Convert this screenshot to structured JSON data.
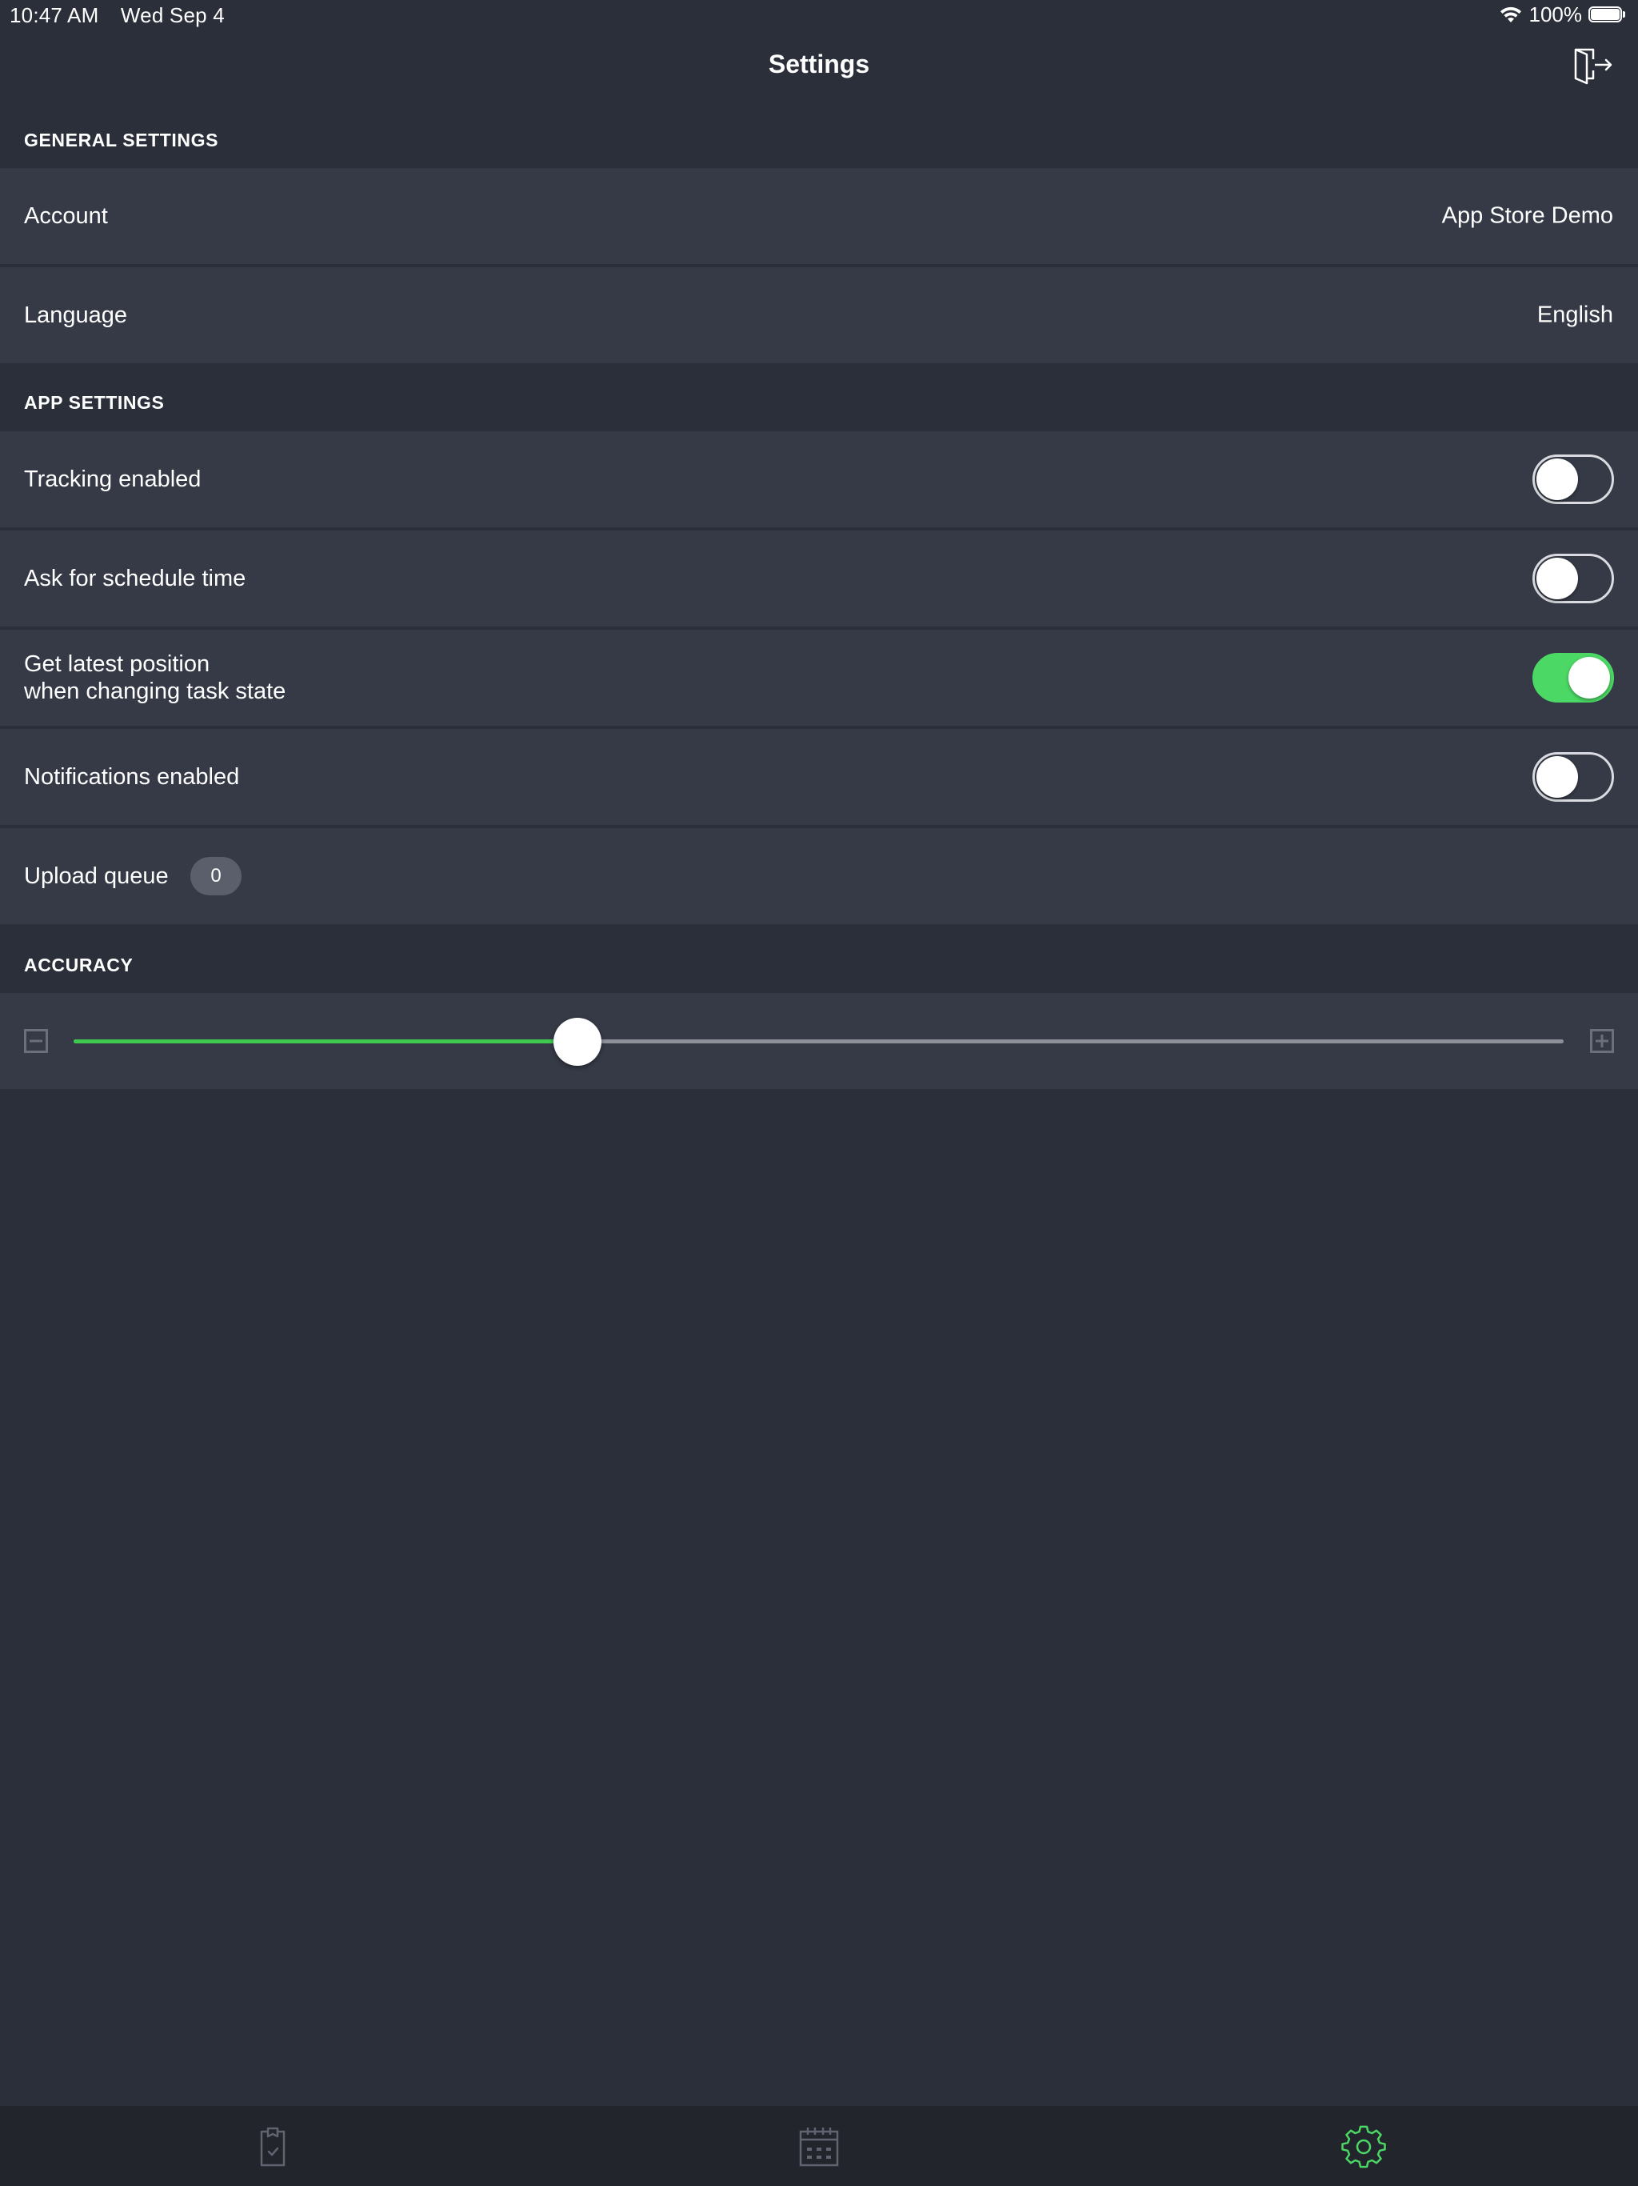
{
  "status_bar": {
    "time": "10:47 AM",
    "date": "Wed Sep 4",
    "battery": "100%"
  },
  "header": {
    "title": "Settings"
  },
  "general_settings": {
    "header": "GENERAL SETTINGS",
    "account_label": "Account",
    "account_value": "App Store Demo",
    "language_label": "Language",
    "language_value": "English"
  },
  "app_settings": {
    "header": "APP SETTINGS",
    "tracking_label": "Tracking enabled",
    "tracking_on": false,
    "schedule_label": "Ask for schedule time",
    "schedule_on": false,
    "position_label_line1": "Get latest position",
    "position_label_line2": "when changing task state",
    "position_on": true,
    "notifications_label": "Notifications enabled",
    "notifications_on": false,
    "upload_queue_label": "Upload queue",
    "upload_queue_count": "0"
  },
  "accuracy": {
    "header": "ACCURACY",
    "level": 0.338
  },
  "tab_bar": {
    "tabs": [
      {
        "icon": "clipboard-check-icon",
        "active": false
      },
      {
        "icon": "calendar-icon",
        "active": false
      },
      {
        "icon": "gear-icon",
        "active": true
      }
    ]
  },
  "colors": {
    "background": "#2b2f39",
    "row": "#353a46",
    "accent": "#4cd864",
    "tab_bar": "#22252c"
  }
}
